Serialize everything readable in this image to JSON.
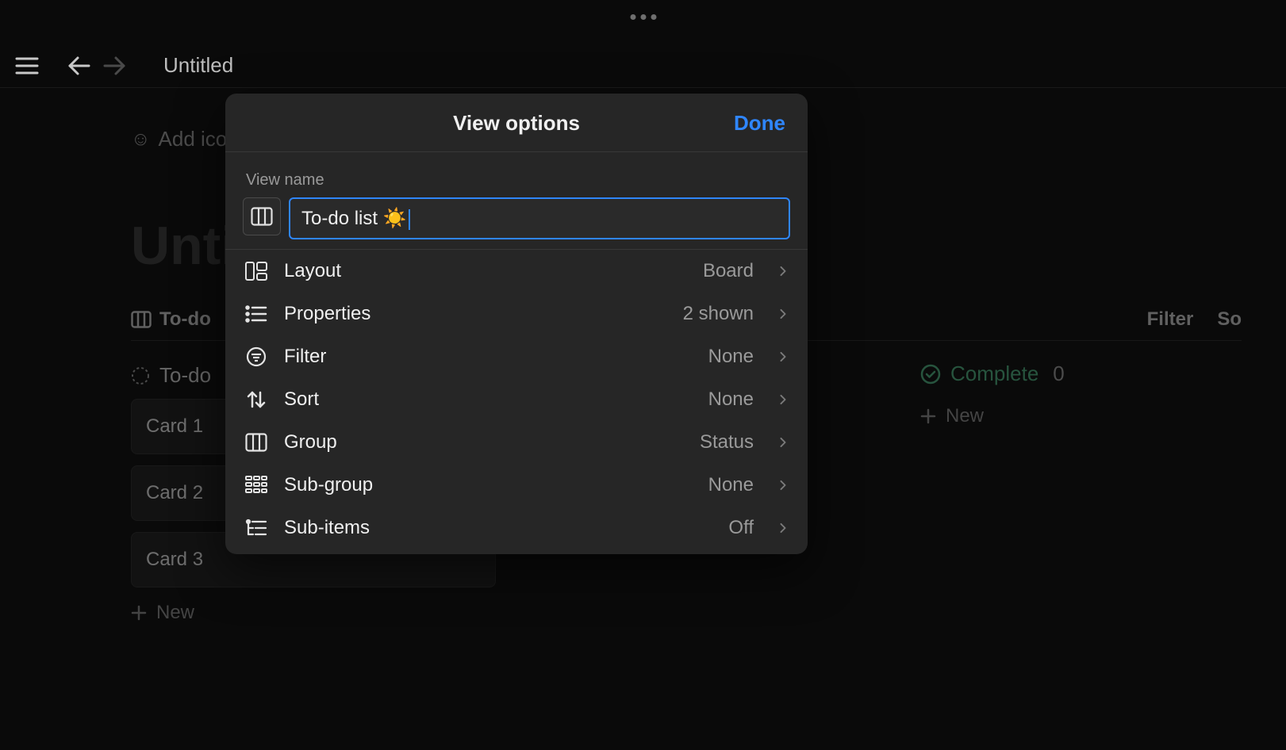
{
  "chrome": {
    "dots": 3
  },
  "topbar": {
    "title": "Untitled"
  },
  "background": {
    "add_icon_label": "Add ico",
    "page_title": "Unti",
    "tab_label": "To-do",
    "toolbar_filter": "Filter",
    "toolbar_sort": "So",
    "columns": {
      "todo": {
        "label": "To-do"
      },
      "complete": {
        "label": "Complete",
        "count": "0"
      }
    },
    "cards": [
      "Card 1",
      "Card 2",
      "Card 3"
    ],
    "new_label": "New",
    "complete_new_label": "New"
  },
  "modal": {
    "title": "View options",
    "done_label": "Done",
    "view_name_label": "View name",
    "view_name_value": "To-do list ☀️",
    "options": [
      {
        "key": "layout",
        "label": "Layout",
        "value": "Board",
        "icon": "layout-icon"
      },
      {
        "key": "properties",
        "label": "Properties",
        "value": "2 shown",
        "icon": "list-icon"
      },
      {
        "key": "filter",
        "label": "Filter",
        "value": "None",
        "icon": "filter-icon"
      },
      {
        "key": "sort",
        "label": "Sort",
        "value": "None",
        "icon": "sort-icon"
      },
      {
        "key": "group",
        "label": "Group",
        "value": "Status",
        "icon": "group-icon"
      },
      {
        "key": "subgroup",
        "label": "Sub-group",
        "value": "None",
        "icon": "subgroup-icon"
      },
      {
        "key": "subitems",
        "label": "Sub-items",
        "value": "Off",
        "icon": "subitems-icon"
      }
    ]
  }
}
